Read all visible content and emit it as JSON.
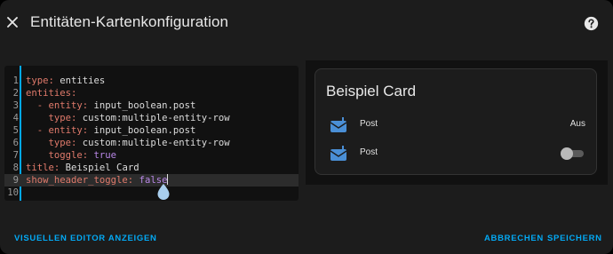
{
  "dialog": {
    "title": "Entitäten-Kartenkonfiguration",
    "close_icon": "close-icon",
    "help_icon": "help-circle-icon"
  },
  "editor": {
    "lines": [
      {
        "n": "1",
        "parts": [
          {
            "t": "type:",
            "c": "k"
          },
          {
            "t": " entities",
            "c": "v"
          }
        ]
      },
      {
        "n": "2",
        "parts": [
          {
            "t": "entities:",
            "c": "k"
          }
        ]
      },
      {
        "n": "3",
        "parts": [
          {
            "t": "  - entity:",
            "c": "k"
          },
          {
            "t": " input_boolean.post",
            "c": "v"
          }
        ]
      },
      {
        "n": "4",
        "parts": [
          {
            "t": "    type:",
            "c": "k"
          },
          {
            "t": " custom:multiple-entity-row",
            "c": "v"
          }
        ]
      },
      {
        "n": "5",
        "parts": [
          {
            "t": "  - entity:",
            "c": "k"
          },
          {
            "t": " input_boolean.post",
            "c": "v"
          }
        ]
      },
      {
        "n": "6",
        "parts": [
          {
            "t": "    type:",
            "c": "k"
          },
          {
            "t": " custom:multiple-entity-row",
            "c": "v"
          }
        ]
      },
      {
        "n": "7",
        "parts": [
          {
            "t": "    toggle:",
            "c": "k"
          },
          {
            "t": " true",
            "c": "bool"
          }
        ]
      },
      {
        "n": "8",
        "parts": [
          {
            "t": "title:",
            "c": "k"
          },
          {
            "t": " Beispiel Card",
            "c": "v"
          }
        ]
      },
      {
        "n": "9",
        "parts": [
          {
            "t": "show_header_toggle:",
            "c": "k"
          },
          {
            "t": " false",
            "c": "bool"
          }
        ],
        "active": true,
        "cursor": true
      },
      {
        "n": "10",
        "parts": []
      }
    ]
  },
  "preview": {
    "card_title": "Beispiel Card",
    "rows": [
      {
        "icon": "mailbox-icon",
        "name": "Post",
        "state": "Aus",
        "toggle": false
      },
      {
        "icon": "mailbox-icon",
        "name": "Post",
        "state": "",
        "toggle": true
      }
    ]
  },
  "footer": {
    "visual_editor": "VISUELLEN EDITOR ANZEIGEN",
    "cancel": "ABBRECHEN",
    "save": "SPEICHERN"
  },
  "colors": {
    "accent": "#03a9f4",
    "key": "#e07a6b",
    "boolean": "#b887e6",
    "mail_icon": "#4a8fd6"
  }
}
